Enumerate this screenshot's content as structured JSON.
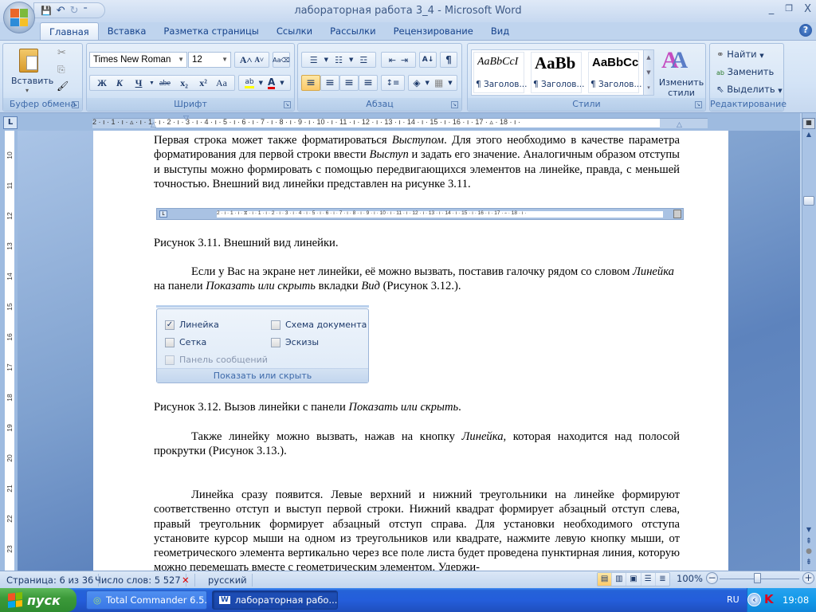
{
  "window": {
    "title": "лабораторная работа 3_4 - Microsoft Word",
    "controls": {
      "minimize": "_",
      "restore": "❐",
      "close": "X"
    }
  },
  "quick_access": {
    "save": "💾",
    "undo": "↶",
    "redo": "↻",
    "customize": "⁼"
  },
  "tabs": [
    {
      "label": "Главная",
      "active": true
    },
    {
      "label": "Вставка"
    },
    {
      "label": "Разметка страницы"
    },
    {
      "label": "Ссылки"
    },
    {
      "label": "Рассылки"
    },
    {
      "label": "Рецензирование"
    },
    {
      "label": "Вид"
    }
  ],
  "help": "?",
  "ribbon": {
    "clipboard": {
      "label": "Буфер обмена",
      "paste": "Вставить",
      "paste_arrow": "▾",
      "cut": "✂",
      "copy": "⎘",
      "format_painter": "🖌"
    },
    "font": {
      "label": "Шрифт",
      "font_name": "Times New Roman",
      "font_size": "12",
      "grow": "A˄",
      "shrink": "A˅",
      "clear": "Aa⌫",
      "bold": "Ж",
      "italic": "К",
      "underline": "Ч",
      "strike": "abe",
      "subscript": "x₂",
      "superscript": "x²",
      "case": "Aa",
      "highlight": "ab",
      "font_color": "A",
      "highlight_color": "#ffff00",
      "font_color_value": "#e00000"
    },
    "paragraph": {
      "label": "Абзац",
      "bullets": "☰",
      "numbering": "☷",
      "multilevel": "☲",
      "decrease_indent": "⇤",
      "increase_indent": "⇥",
      "sort": "A↓",
      "show_marks": "¶",
      "align_left": "≡",
      "align_center": "≡",
      "align_right": "≡",
      "justify": "≡",
      "line_spacing": "↕≡",
      "shading": "◈",
      "borders": "▦"
    },
    "styles": {
      "label": "Стили",
      "tiles": [
        {
          "sample": "AaBbCcI",
          "name": "¶ Заголов..."
        },
        {
          "sample": "AaBb",
          "name": "¶ Заголов..."
        },
        {
          "sample": "AaBbCc",
          "name": "¶ Заголов..."
        }
      ],
      "change_styles": "Изменить стили"
    },
    "editing": {
      "label": "Редактирование",
      "find": "Найти",
      "replace": "Заменить",
      "select": "Выделить"
    }
  },
  "ruler": {
    "tab_selector": "L",
    "numbers": "2 · ı · 1 · ı · ▵ · ı · 1 · ı · 2 · ı · 3 · ı · 4 · ı · 5 · ı · 6 · ı · 7 · ı · 8 · ı · 9 · ı · 10 · ı · 11 · ı · 12 · ı · 13 · ı · 14 · ı · 15 · ı · 16 · ı · 17 · ▵ · 18 · ı ·",
    "vertical_numbers": [
      "10",
      "11",
      "12",
      "13",
      "14",
      "15",
      "16",
      "17",
      "18",
      "19",
      "20",
      "21",
      "22",
      "23"
    ]
  },
  "document": {
    "p1": [
      {
        "t": "Первая строка может также форматироваться "
      },
      {
        "t": "Выступом",
        "i": true
      },
      {
        "t": ". Для этого необходимо в качестве параметра форматирования для первой строки ввести "
      },
      {
        "t": "Выступ",
        "i": true
      },
      {
        "t": " и задать его значение. Аналогичным образом отступы и выступы можно формировать с помощью передвигающихся элементов на линейке, правда, с меньшей точностью. Внешний вид линейки представлен на рисунке 3.11."
      }
    ],
    "fig311_ruler_numbers": "2 · ı · 1 · ı · ⧖ · ı · 1 · ı · 2 · ı · 3 · ı · 4 · ı · 5 · ı · 6 · ı · 7 · ı · 8 · ı · 9 · ı · 10 · ı · 11 · ı · 12 · ı · 13 · ı · 14 · ı · 15 · ı · 16 · ı · 17 · ▵ · 18 · ı ·",
    "caption311": "Рисунок 3.11. Внешний вид линейки.",
    "p2": [
      {
        "t": "Если у Вас на экране нет линейки, её можно вызвать, поставив галочку рядом со словом "
      },
      {
        "t": "Линейка",
        "i": true
      },
      {
        "t": " на панели "
      },
      {
        "t": "Показать или скрыть",
        "i": true
      },
      {
        "t": " вкладки "
      },
      {
        "t": "Вид",
        "i": true
      },
      {
        "t": " (Рисунок 3.12.)."
      }
    ],
    "fig312": {
      "items": [
        {
          "label": "Линейка",
          "checked": true,
          "mark": "✓"
        },
        {
          "label": "Схема документа",
          "checked": false
        },
        {
          "label": "Сетка",
          "checked": false
        },
        {
          "label": "Эскизы",
          "checked": false
        },
        {
          "label": "Панель сообщений",
          "checked": false,
          "disabled": true
        }
      ],
      "group_label": "Показать или скрыть"
    },
    "caption312": [
      {
        "t": "Рисунок 3.12. Вызов линейки с панели "
      },
      {
        "t": "Показать или скрыть",
        "i": true
      },
      {
        "t": "."
      }
    ],
    "p3": [
      {
        "t": "Также линейку можно вызвать, нажав на кнопку "
      },
      {
        "t": "Линейка",
        "i": true
      },
      {
        "t": ", которая находится над полосой прокрутки (Рисунок 3.13.)."
      }
    ],
    "p4": [
      {
        "t": "Линейка сразу появится. Левые верхний и нижний треугольники на линейке формируют соответственно отступ и выступ первой строки. Нижний квадрат формирует абзацный отступ слева, правый треугольник формирует абзацный отступ справа. Для установки необходимого отступа установите курсор мыши на одном из треугольников или квадрате, нажмите левую кнопку мыши, от геометрического элемента вертикально через все поле листа будет проведена пунктирная линия, которую можно перемещать вместе с геометрическим элементом. Удержи-"
      }
    ]
  },
  "statusbar": {
    "page": "Страница: 6 из 36",
    "words": "Число слов: 5 527",
    "proofing_icon": "✕",
    "language": "русский",
    "views": [
      "▤",
      "📖",
      "🖥",
      "☰",
      "≣"
    ],
    "zoom": "100%",
    "zoom_minus": "−",
    "zoom_plus": "+",
    "zoom_level_percent": 100
  },
  "scrollbar": {
    "up": "▲",
    "down": "▼",
    "prev_page": "⯭",
    "browse": "●",
    "next_page": "⯯",
    "position_fraction": 0.17
  },
  "taskbar": {
    "start": "пуск",
    "tasks": [
      {
        "label": "Total Commander 6.5...",
        "icon": "◎"
      },
      {
        "label": "лабораторная рабо...",
        "icon": "W"
      }
    ],
    "lang": "RU",
    "tray_arrow": "‹",
    "kav": "K",
    "clock": "19:08"
  }
}
